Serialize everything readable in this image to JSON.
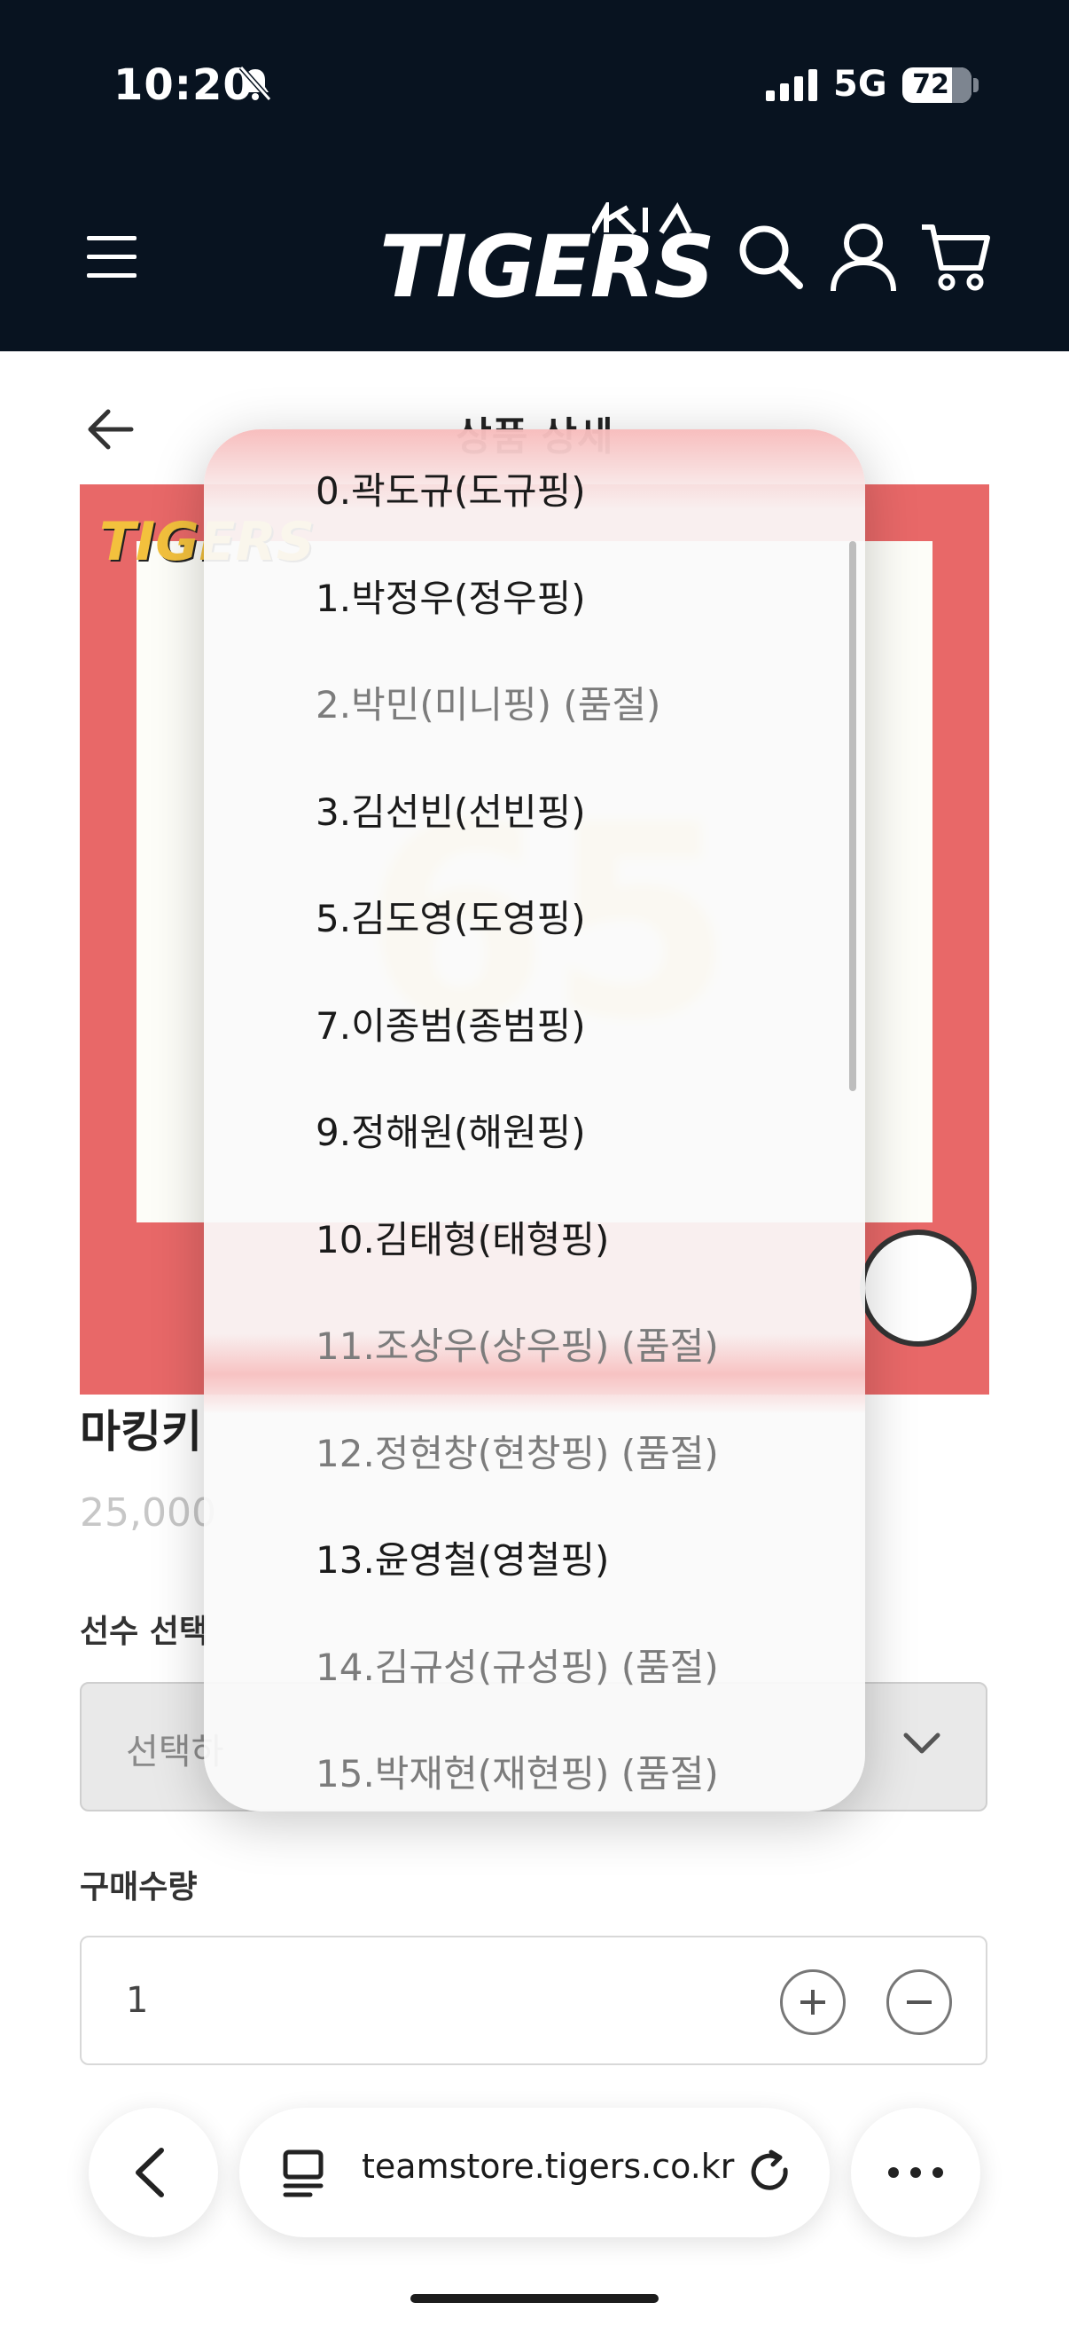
{
  "status_bar": {
    "time": "10:20",
    "network": "5G",
    "battery": "72",
    "battery_fraction": 0.72
  },
  "header": {
    "logo_text": "TIGERS"
  },
  "page": {
    "title": "상품 상세"
  },
  "product": {
    "name": "마킹키",
    "price": "25,000",
    "player_select_label": "선수 선택",
    "player_select_placeholder": "선택하",
    "quantity_label": "구매수량",
    "quantity_value": "1"
  },
  "picker": {
    "options": [
      {
        "label": "0.곽도규(도규핑)",
        "sold_out": false
      },
      {
        "label": "1.박정우(정우핑)",
        "sold_out": false
      },
      {
        "label": "2.박민(미니핑) (품절)",
        "sold_out": true
      },
      {
        "label": "3.김선빈(선빈핑)",
        "sold_out": false
      },
      {
        "label": "5.김도영(도영핑)",
        "sold_out": false
      },
      {
        "label": "7.이종범(종범핑)",
        "sold_out": false
      },
      {
        "label": "9.정해원(해원핑)",
        "sold_out": false
      },
      {
        "label": "10.김태형(태형핑)",
        "sold_out": false
      },
      {
        "label": "11.조상우(상우핑) (품절)",
        "sold_out": true
      },
      {
        "label": "12.정현창(현창핑) (품절)",
        "sold_out": true
      },
      {
        "label": "13.윤영철(영철핑)",
        "sold_out": false
      },
      {
        "label": "14.김규성(규성핑) (품절)",
        "sold_out": true
      },
      {
        "label": "15.박재현(재현핑) (품절)",
        "sold_out": true
      }
    ]
  },
  "browser": {
    "url": "teamstore.tigers.co.kr"
  }
}
